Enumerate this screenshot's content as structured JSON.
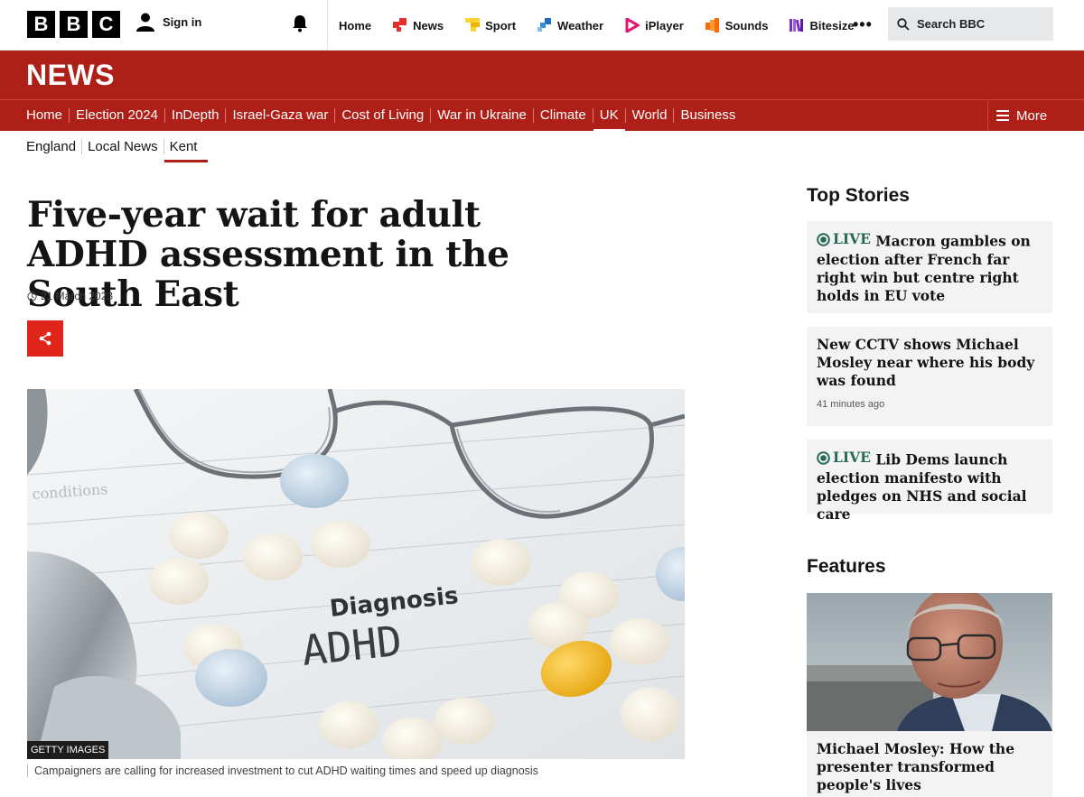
{
  "header": {
    "logo_letters": [
      "B",
      "B",
      "C"
    ],
    "sign_in": "Sign in",
    "nav": [
      {
        "label": "Home",
        "color": ""
      },
      {
        "label": "News",
        "color": "#e3312b"
      },
      {
        "label": "Sport",
        "color": "#ffd230"
      },
      {
        "label": "Weather",
        "color": "#3a8bd6"
      },
      {
        "label": "iPlayer",
        "color": "#e4136c"
      },
      {
        "label": "Sounds",
        "color": "#ff6a00"
      },
      {
        "label": "Bitesize",
        "color": "#7b2ec2"
      }
    ],
    "more": "•••",
    "search_label": "Search BBC"
  },
  "banner": {
    "title": "NEWS"
  },
  "main_nav": {
    "items": [
      "Home",
      "Election 2024",
      "InDepth",
      "Israel-Gaza war",
      "Cost of Living",
      "War in Ukraine",
      "Climate",
      "UK",
      "World",
      "Business"
    ],
    "active": "UK",
    "more": "More"
  },
  "sub_nav": {
    "items": [
      "England",
      "Local News",
      "Kent"
    ],
    "active": "Kent"
  },
  "article": {
    "headline": "Five-year wait for adult ADHD assessment in the South East",
    "date": "21 March 2023",
    "image_credit": "GETTY IMAGES",
    "image_text_1": "Diagnosis",
    "image_text_2": "ADHD",
    "image_text_3": "conditions",
    "caption": "Campaigners are calling for increased investment to cut ADHD waiting times and speed up diagnosis"
  },
  "sidebar": {
    "top_stories_heading": "Top Stories",
    "stories": [
      {
        "live": "LIVE",
        "text": "Macron gambles on election after French far right win but centre right holds in EU vote",
        "ago": ""
      },
      {
        "live": "",
        "text": "New CCTV shows Michael Mosley near where his body was found",
        "ago": "41 minutes ago"
      },
      {
        "live": "LIVE",
        "text": "Lib Dems launch election manifesto with pledges on NHS and social care",
        "ago": ""
      }
    ],
    "features_heading": "Features",
    "feature": {
      "text": "Michael Mosley: How the presenter transformed people's lives"
    }
  },
  "colors": {
    "news_red": "#ad1f17",
    "share_red": "#e0261b",
    "live_green": "#276a57"
  }
}
